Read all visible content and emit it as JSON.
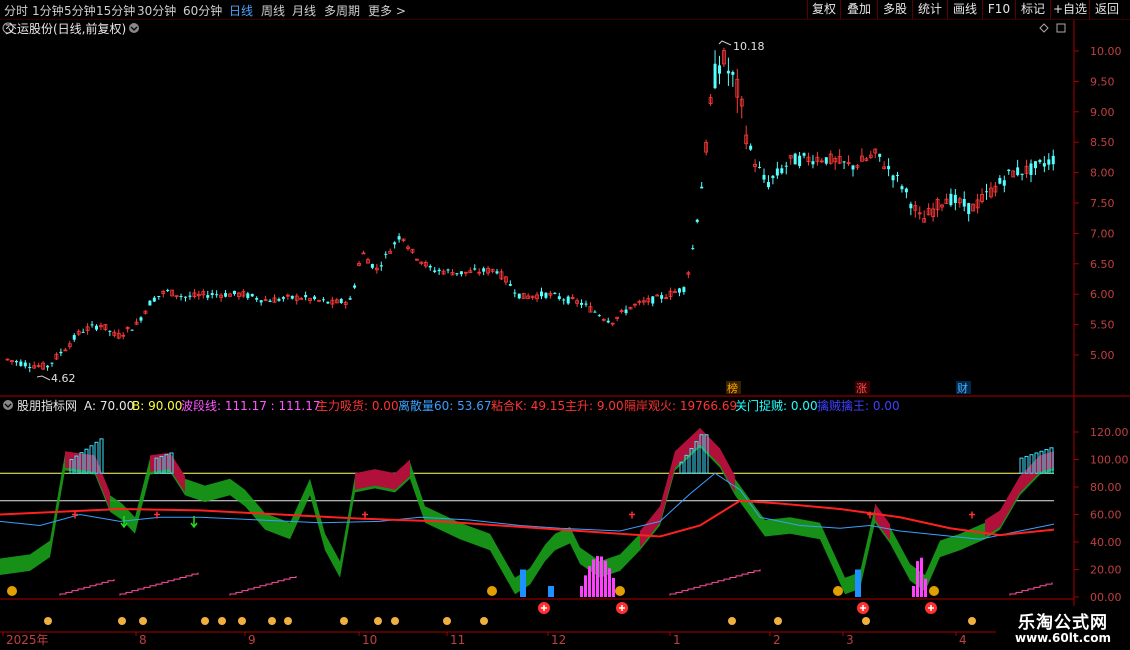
{
  "topbar": {
    "periods": [
      "分时",
      "1分钟",
      "5分钟",
      "15分钟",
      "30分钟",
      "60分钟",
      "日线",
      "周线",
      "月线",
      "多周期",
      "更多 >"
    ],
    "active_period": "日线",
    "right_buttons": [
      "复权",
      "叠加",
      "多股",
      "统计",
      "画线",
      "F10",
      "标记",
      "+自选",
      "返回"
    ]
  },
  "main": {
    "title": "交运股份(日线,前复权)",
    "high_label": "10.18",
    "low_label": "4.62",
    "y_ticks": [
      "10.00",
      "9.50",
      "9.00",
      "8.50",
      "8.00",
      "7.50",
      "7.00",
      "6.50",
      "6.00",
      "5.50",
      "5.00"
    ],
    "event_tags": [
      "榜",
      "涨",
      "财"
    ]
  },
  "indicator": {
    "name": "股朋指标网",
    "values": [
      {
        "text": "A: 70.00",
        "color": "#e8e8e8"
      },
      {
        "text": "B: 90.00",
        "color": "#ffff3a"
      },
      {
        "text": "波段线: 111.17 : 111.17",
        "color": "#ff55ff"
      },
      {
        "text": "主力吸货: 0.00",
        "color": "#ff3333"
      },
      {
        "text": "离散量60: 53.67",
        "color": "#3aa0ff"
      },
      {
        "text": "粘合K: 49.15",
        "color": "#ff3333"
      },
      {
        "text": "主升: 9.00",
        "color": "#ff3333"
      },
      {
        "text": "隔岸观火: 19766.69",
        "color": "#ff3333"
      },
      {
        "text": "关门捉贼: 0.00",
        "color": "#22ffff"
      },
      {
        "text": "擒贼擒王: 0.00",
        "color": "#4040ff"
      }
    ],
    "y_ticks": [
      "120.00",
      "100.00",
      "80.00",
      "60.00",
      "40.00",
      "20.00",
      "00.00"
    ],
    "line_a": 70,
    "line_b": 90
  },
  "time_axis": [
    "2025年",
    "8",
    "9",
    "10",
    "11",
    "12",
    "1",
    "2",
    "3",
    "4"
  ],
  "watermark": {
    "title": "乐淘公式网",
    "url": "www.60lt.com"
  },
  "colors": {
    "up": "#ff3a3a",
    "down": "#54ffff",
    "ma_red": "#ff2020",
    "ma_blue": "#3aa0ff",
    "green": "#22cc22",
    "crimson": "#b0103a",
    "axis_red": "#aa0000"
  }
}
